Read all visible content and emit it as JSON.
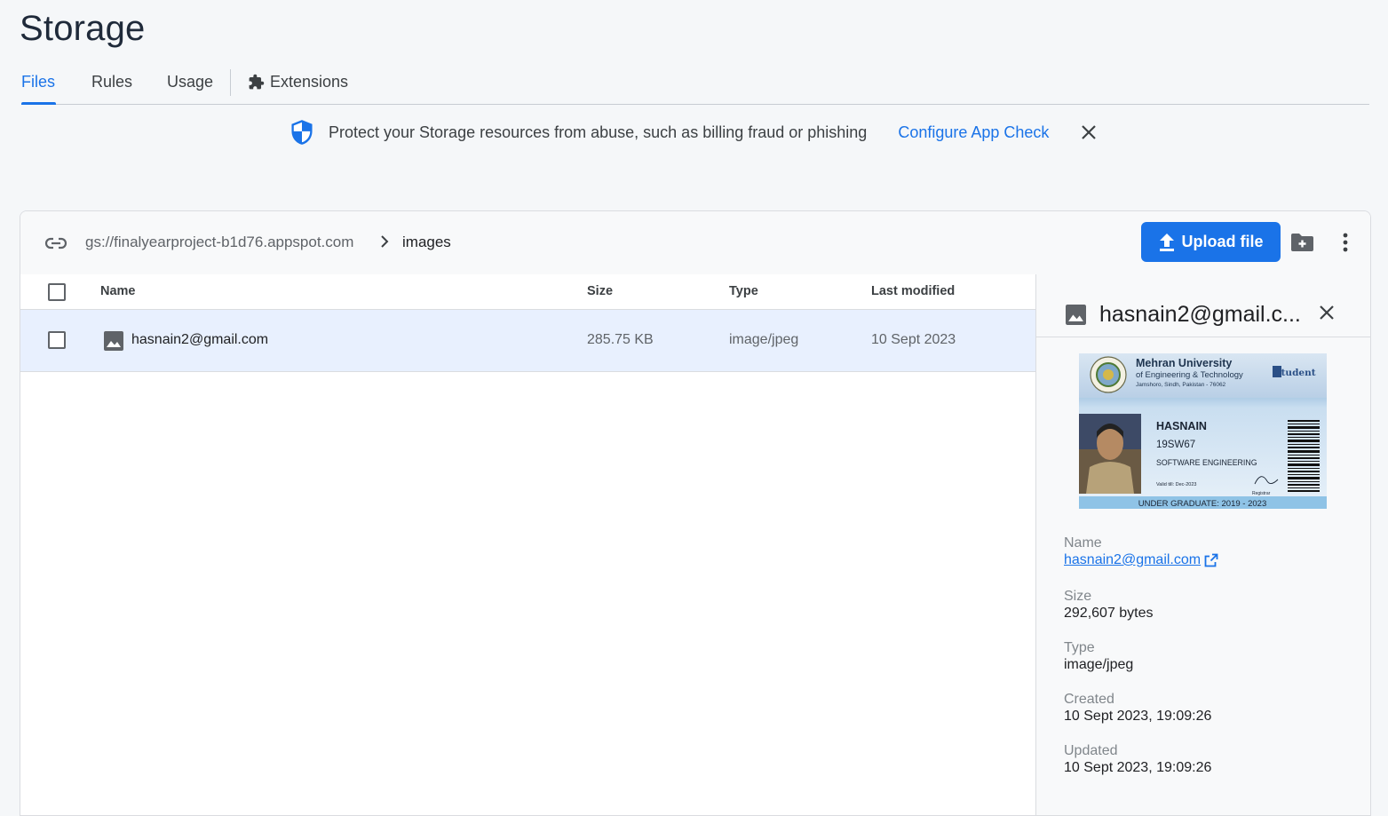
{
  "page": {
    "title": "Storage"
  },
  "tabs": [
    {
      "label": "Files"
    },
    {
      "label": "Rules"
    },
    {
      "label": "Usage"
    },
    {
      "label": "Extensions"
    }
  ],
  "banner": {
    "text": "Protect your Storage resources from abuse, such as billing fraud or phishing",
    "link": "Configure App Check",
    "icon": "shield-icon"
  },
  "bucket": {
    "path": "gs://finalyearproject-b1d76.appspot.com",
    "folder": "images",
    "upload_label": "Upload file"
  },
  "table": {
    "columns": [
      "Name",
      "Size",
      "Type",
      "Last modified"
    ],
    "rows": [
      {
        "name": "hasnain2@gmail.com",
        "size": "285.75 KB",
        "type": "image/jpeg",
        "modified": "10 Sept 2023"
      }
    ]
  },
  "details": {
    "title": "hasnain2@gmail.c...",
    "preview": {
      "university": "Mehran University",
      "university_sub": "of Engineering & Technology",
      "address": "Jamshoro, Sindh, Pakistan - 76062",
      "badge": "Student",
      "student_name": "HASNAIN",
      "roll": "19SW67",
      "dept": "SOFTWARE ENGINEERING",
      "valid": "Valid till: Dec-2023",
      "registrar": "Registrar",
      "footer": "UNDER GRADUATE: 2019 - 2023"
    },
    "name_label": "Name",
    "name_value": "hasnain2@gmail.com",
    "size_label": "Size",
    "size_value": "292,607 bytes",
    "type_label": "Type",
    "type_value": "image/jpeg",
    "created_label": "Created",
    "created_value": "10 Sept 2023, 19:09:26",
    "updated_label": "Updated",
    "updated_value": "10 Sept 2023, 19:09:26"
  },
  "colors": {
    "accent": "#1a73e8",
    "row_selected": "#e8f0fe"
  }
}
